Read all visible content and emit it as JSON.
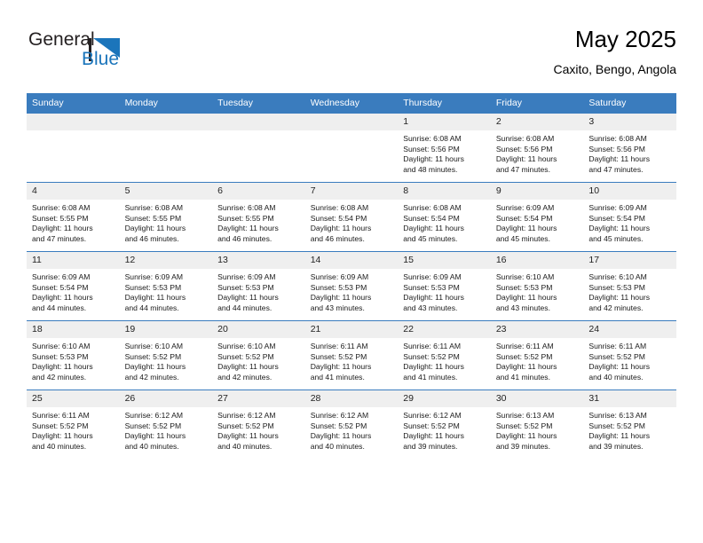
{
  "brand": {
    "name_part1": "General",
    "name_part2": "Blue",
    "accent_color": "#1b75bb"
  },
  "header": {
    "title": "May 2025",
    "subtitle": "Caxito, Bengo, Angola"
  },
  "theme": {
    "header_row_color": "#3a7cbe",
    "daynum_band_color": "#efefef"
  },
  "weekdays": [
    "Sunday",
    "Monday",
    "Tuesday",
    "Wednesday",
    "Thursday",
    "Friday",
    "Saturday"
  ],
  "labels": {
    "sunrise_prefix": "Sunrise:",
    "sunset_prefix": "Sunset:",
    "daylight_prefix": "Daylight:"
  },
  "weeks": [
    [
      {
        "day": "",
        "empty": true
      },
      {
        "day": "",
        "empty": true
      },
      {
        "day": "",
        "empty": true
      },
      {
        "day": "",
        "empty": true
      },
      {
        "day": "1",
        "sunrise": "Sunrise: 6:08 AM",
        "sunset": "Sunset: 5:56 PM",
        "daylight_l1": "Daylight: 11 hours",
        "daylight_l2": "and 48 minutes."
      },
      {
        "day": "2",
        "sunrise": "Sunrise: 6:08 AM",
        "sunset": "Sunset: 5:56 PM",
        "daylight_l1": "Daylight: 11 hours",
        "daylight_l2": "and 47 minutes."
      },
      {
        "day": "3",
        "sunrise": "Sunrise: 6:08 AM",
        "sunset": "Sunset: 5:56 PM",
        "daylight_l1": "Daylight: 11 hours",
        "daylight_l2": "and 47 minutes."
      }
    ],
    [
      {
        "day": "4",
        "sunrise": "Sunrise: 6:08 AM",
        "sunset": "Sunset: 5:55 PM",
        "daylight_l1": "Daylight: 11 hours",
        "daylight_l2": "and 47 minutes."
      },
      {
        "day": "5",
        "sunrise": "Sunrise: 6:08 AM",
        "sunset": "Sunset: 5:55 PM",
        "daylight_l1": "Daylight: 11 hours",
        "daylight_l2": "and 46 minutes."
      },
      {
        "day": "6",
        "sunrise": "Sunrise: 6:08 AM",
        "sunset": "Sunset: 5:55 PM",
        "daylight_l1": "Daylight: 11 hours",
        "daylight_l2": "and 46 minutes."
      },
      {
        "day": "7",
        "sunrise": "Sunrise: 6:08 AM",
        "sunset": "Sunset: 5:54 PM",
        "daylight_l1": "Daylight: 11 hours",
        "daylight_l2": "and 46 minutes."
      },
      {
        "day": "8",
        "sunrise": "Sunrise: 6:08 AM",
        "sunset": "Sunset: 5:54 PM",
        "daylight_l1": "Daylight: 11 hours",
        "daylight_l2": "and 45 minutes."
      },
      {
        "day": "9",
        "sunrise": "Sunrise: 6:09 AM",
        "sunset": "Sunset: 5:54 PM",
        "daylight_l1": "Daylight: 11 hours",
        "daylight_l2": "and 45 minutes."
      },
      {
        "day": "10",
        "sunrise": "Sunrise: 6:09 AM",
        "sunset": "Sunset: 5:54 PM",
        "daylight_l1": "Daylight: 11 hours",
        "daylight_l2": "and 45 minutes."
      }
    ],
    [
      {
        "day": "11",
        "sunrise": "Sunrise: 6:09 AM",
        "sunset": "Sunset: 5:54 PM",
        "daylight_l1": "Daylight: 11 hours",
        "daylight_l2": "and 44 minutes."
      },
      {
        "day": "12",
        "sunrise": "Sunrise: 6:09 AM",
        "sunset": "Sunset: 5:53 PM",
        "daylight_l1": "Daylight: 11 hours",
        "daylight_l2": "and 44 minutes."
      },
      {
        "day": "13",
        "sunrise": "Sunrise: 6:09 AM",
        "sunset": "Sunset: 5:53 PM",
        "daylight_l1": "Daylight: 11 hours",
        "daylight_l2": "and 44 minutes."
      },
      {
        "day": "14",
        "sunrise": "Sunrise: 6:09 AM",
        "sunset": "Sunset: 5:53 PM",
        "daylight_l1": "Daylight: 11 hours",
        "daylight_l2": "and 43 minutes."
      },
      {
        "day": "15",
        "sunrise": "Sunrise: 6:09 AM",
        "sunset": "Sunset: 5:53 PM",
        "daylight_l1": "Daylight: 11 hours",
        "daylight_l2": "and 43 minutes."
      },
      {
        "day": "16",
        "sunrise": "Sunrise: 6:10 AM",
        "sunset": "Sunset: 5:53 PM",
        "daylight_l1": "Daylight: 11 hours",
        "daylight_l2": "and 43 minutes."
      },
      {
        "day": "17",
        "sunrise": "Sunrise: 6:10 AM",
        "sunset": "Sunset: 5:53 PM",
        "daylight_l1": "Daylight: 11 hours",
        "daylight_l2": "and 42 minutes."
      }
    ],
    [
      {
        "day": "18",
        "sunrise": "Sunrise: 6:10 AM",
        "sunset": "Sunset: 5:53 PM",
        "daylight_l1": "Daylight: 11 hours",
        "daylight_l2": "and 42 minutes."
      },
      {
        "day": "19",
        "sunrise": "Sunrise: 6:10 AM",
        "sunset": "Sunset: 5:52 PM",
        "daylight_l1": "Daylight: 11 hours",
        "daylight_l2": "and 42 minutes."
      },
      {
        "day": "20",
        "sunrise": "Sunrise: 6:10 AM",
        "sunset": "Sunset: 5:52 PM",
        "daylight_l1": "Daylight: 11 hours",
        "daylight_l2": "and 42 minutes."
      },
      {
        "day": "21",
        "sunrise": "Sunrise: 6:11 AM",
        "sunset": "Sunset: 5:52 PM",
        "daylight_l1": "Daylight: 11 hours",
        "daylight_l2": "and 41 minutes."
      },
      {
        "day": "22",
        "sunrise": "Sunrise: 6:11 AM",
        "sunset": "Sunset: 5:52 PM",
        "daylight_l1": "Daylight: 11 hours",
        "daylight_l2": "and 41 minutes."
      },
      {
        "day": "23",
        "sunrise": "Sunrise: 6:11 AM",
        "sunset": "Sunset: 5:52 PM",
        "daylight_l1": "Daylight: 11 hours",
        "daylight_l2": "and 41 minutes."
      },
      {
        "day": "24",
        "sunrise": "Sunrise: 6:11 AM",
        "sunset": "Sunset: 5:52 PM",
        "daylight_l1": "Daylight: 11 hours",
        "daylight_l2": "and 40 minutes."
      }
    ],
    [
      {
        "day": "25",
        "sunrise": "Sunrise: 6:11 AM",
        "sunset": "Sunset: 5:52 PM",
        "daylight_l1": "Daylight: 11 hours",
        "daylight_l2": "and 40 minutes."
      },
      {
        "day": "26",
        "sunrise": "Sunrise: 6:12 AM",
        "sunset": "Sunset: 5:52 PM",
        "daylight_l1": "Daylight: 11 hours",
        "daylight_l2": "and 40 minutes."
      },
      {
        "day": "27",
        "sunrise": "Sunrise: 6:12 AM",
        "sunset": "Sunset: 5:52 PM",
        "daylight_l1": "Daylight: 11 hours",
        "daylight_l2": "and 40 minutes."
      },
      {
        "day": "28",
        "sunrise": "Sunrise: 6:12 AM",
        "sunset": "Sunset: 5:52 PM",
        "daylight_l1": "Daylight: 11 hours",
        "daylight_l2": "and 40 minutes."
      },
      {
        "day": "29",
        "sunrise": "Sunrise: 6:12 AM",
        "sunset": "Sunset: 5:52 PM",
        "daylight_l1": "Daylight: 11 hours",
        "daylight_l2": "and 39 minutes."
      },
      {
        "day": "30",
        "sunrise": "Sunrise: 6:13 AM",
        "sunset": "Sunset: 5:52 PM",
        "daylight_l1": "Daylight: 11 hours",
        "daylight_l2": "and 39 minutes."
      },
      {
        "day": "31",
        "sunrise": "Sunrise: 6:13 AM",
        "sunset": "Sunset: 5:52 PM",
        "daylight_l1": "Daylight: 11 hours",
        "daylight_l2": "and 39 minutes."
      }
    ]
  ]
}
